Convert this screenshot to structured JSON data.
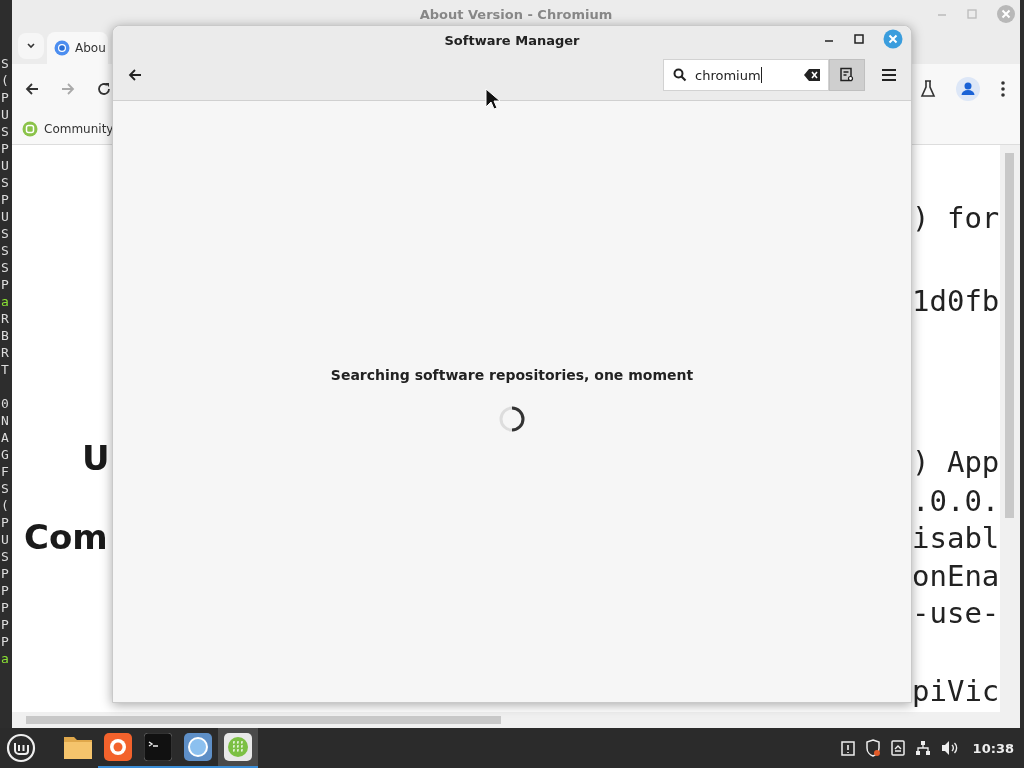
{
  "terminal": {
    "lines": [
      {
        "text": "S",
        "kind": "plain"
      },
      {
        "text": "(",
        "kind": "plain"
      },
      {
        "text": "P",
        "kind": "plain"
      },
      {
        "text": "U",
        "kind": "plain"
      },
      {
        "text": "S",
        "kind": "plain"
      },
      {
        "text": "P",
        "kind": "plain"
      },
      {
        "text": "U",
        "kind": "plain"
      },
      {
        "text": "S",
        "kind": "plain"
      },
      {
        "text": "P",
        "kind": "plain"
      },
      {
        "text": "U",
        "kind": "plain"
      },
      {
        "text": "S",
        "kind": "plain"
      },
      {
        "text": "S",
        "kind": "plain"
      },
      {
        "text": "S",
        "kind": "plain"
      },
      {
        "text": "P",
        "kind": "plain"
      },
      {
        "text": "a",
        "kind": "prompt"
      },
      {
        "text": "R",
        "kind": "plain"
      },
      {
        "text": "B",
        "kind": "plain"
      },
      {
        "text": "R",
        "kind": "plain"
      },
      {
        "text": "T",
        "kind": "plain"
      },
      {
        "kind": "blank"
      },
      {
        "text": "0",
        "kind": "plain"
      },
      {
        "text": "N",
        "kind": "plain"
      },
      {
        "text": "A",
        "kind": "plain"
      },
      {
        "text": "G",
        "kind": "plain"
      },
      {
        "text": "F",
        "kind": "plain"
      },
      {
        "text": "S",
        "kind": "plain"
      },
      {
        "text": "(",
        "kind": "plain"
      },
      {
        "text": "P",
        "kind": "plain"
      },
      {
        "text": "U",
        "kind": "plain"
      },
      {
        "text": "S",
        "kind": "plain"
      },
      {
        "text": "P",
        "kind": "plain"
      },
      {
        "text": "P",
        "kind": "plain"
      },
      {
        "text": "P",
        "kind": "plain"
      },
      {
        "text": "P",
        "kind": "plain"
      },
      {
        "text": "P",
        "kind": "plain"
      },
      {
        "text": "a",
        "kind": "prompt"
      }
    ]
  },
  "browser": {
    "title": "About Version - Chromium",
    "tab": {
      "label": "Abou"
    },
    "bookmark": {
      "label": "Community"
    },
    "page": {
      "headings": [
        "U",
        "Com"
      ],
      "code_lines": [
        ") for",
        "1d0fb",
        ") App",
        ".0.0.",
        "isabl",
        "onEna",
        "-use-",
        "piVic"
      ]
    }
  },
  "software_manager": {
    "title": "Software Manager",
    "search": {
      "value": "chromium"
    },
    "status": "Searching software repositories, one moment"
  },
  "taskbar": {
    "apps": [
      {
        "kind": "files",
        "running": false,
        "selected": false
      },
      {
        "kind": "firefox",
        "running": true,
        "selected": false
      },
      {
        "kind": "terminal",
        "running": true,
        "selected": false
      },
      {
        "kind": "browser",
        "running": true,
        "selected": false
      },
      {
        "kind": "software",
        "running": true,
        "selected": true
      }
    ],
    "clock": "10:38"
  }
}
